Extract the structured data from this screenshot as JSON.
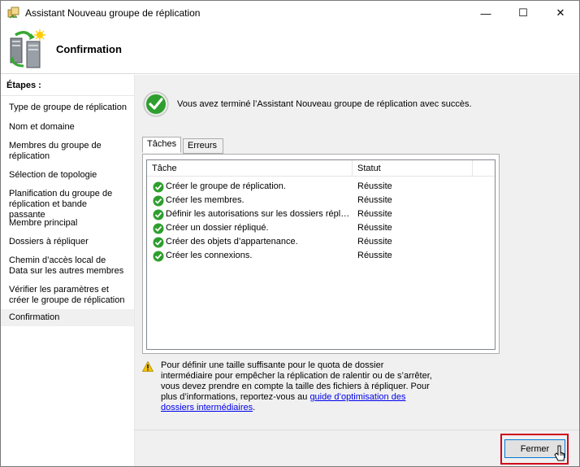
{
  "window": {
    "title": "Assistant Nouveau groupe de réplication",
    "controls": {
      "minimize": "—",
      "maximize": "☐",
      "close": "✕"
    }
  },
  "header": {
    "title": "Confirmation",
    "icon": "replication-wizard-icon"
  },
  "sidebar": {
    "steps_label": "Étapes :",
    "steps": [
      "Type de groupe de réplication",
      "Nom et domaine",
      "Membres du groupe de réplication",
      "Sélection de topologie",
      "Planification du groupe de réplication et bande passante",
      "Membre principal",
      "Dossiers à répliquer",
      "Chemin d’accès local de Data sur les autres membres",
      "Vérifier les paramètres et créer le groupe de réplication",
      "Confirmation"
    ],
    "active_index": 9
  },
  "main": {
    "success_message": "Vous avez terminé l’Assistant Nouveau groupe de réplication avec succès.",
    "tabs": [
      {
        "label": "Tâches",
        "selected": true
      },
      {
        "label": "Erreurs",
        "selected": false
      }
    ],
    "table": {
      "columns": [
        "Tâche",
        "Statut"
      ],
      "rows": [
        {
          "task": "Créer le groupe de réplication.",
          "status": "Réussite"
        },
        {
          "task": "Créer les membres.",
          "status": "Réussite"
        },
        {
          "task": "Définir les autorisations sur les dossiers répliqués...",
          "status": "Réussite"
        },
        {
          "task": "Créer un dossier répliqué.",
          "status": "Réussite"
        },
        {
          "task": "Créer des objets d’appartenance.",
          "status": "Réussite"
        },
        {
          "task": "Créer les connexions.",
          "status": "Réussite"
        }
      ]
    },
    "warning": {
      "text": "Pour définir une taille suffisante pour le quota de dossier intermédiaire pour empêcher la réplication de ralentir ou de s’arrêter, vous devez prendre en compte la taille des fichiers à répliquer. Pour plus d’informations, reportez-vous au ",
      "link": "guide d’optimisation des dossiers intermédiaires",
      "suffix": "."
    }
  },
  "footer": {
    "close_label": "Fermer"
  },
  "colors": {
    "success_green": "#2e9e2e",
    "warning_yellow": "#f5c400",
    "highlight_red": "#d0021b",
    "link_blue": "#0000ee"
  }
}
